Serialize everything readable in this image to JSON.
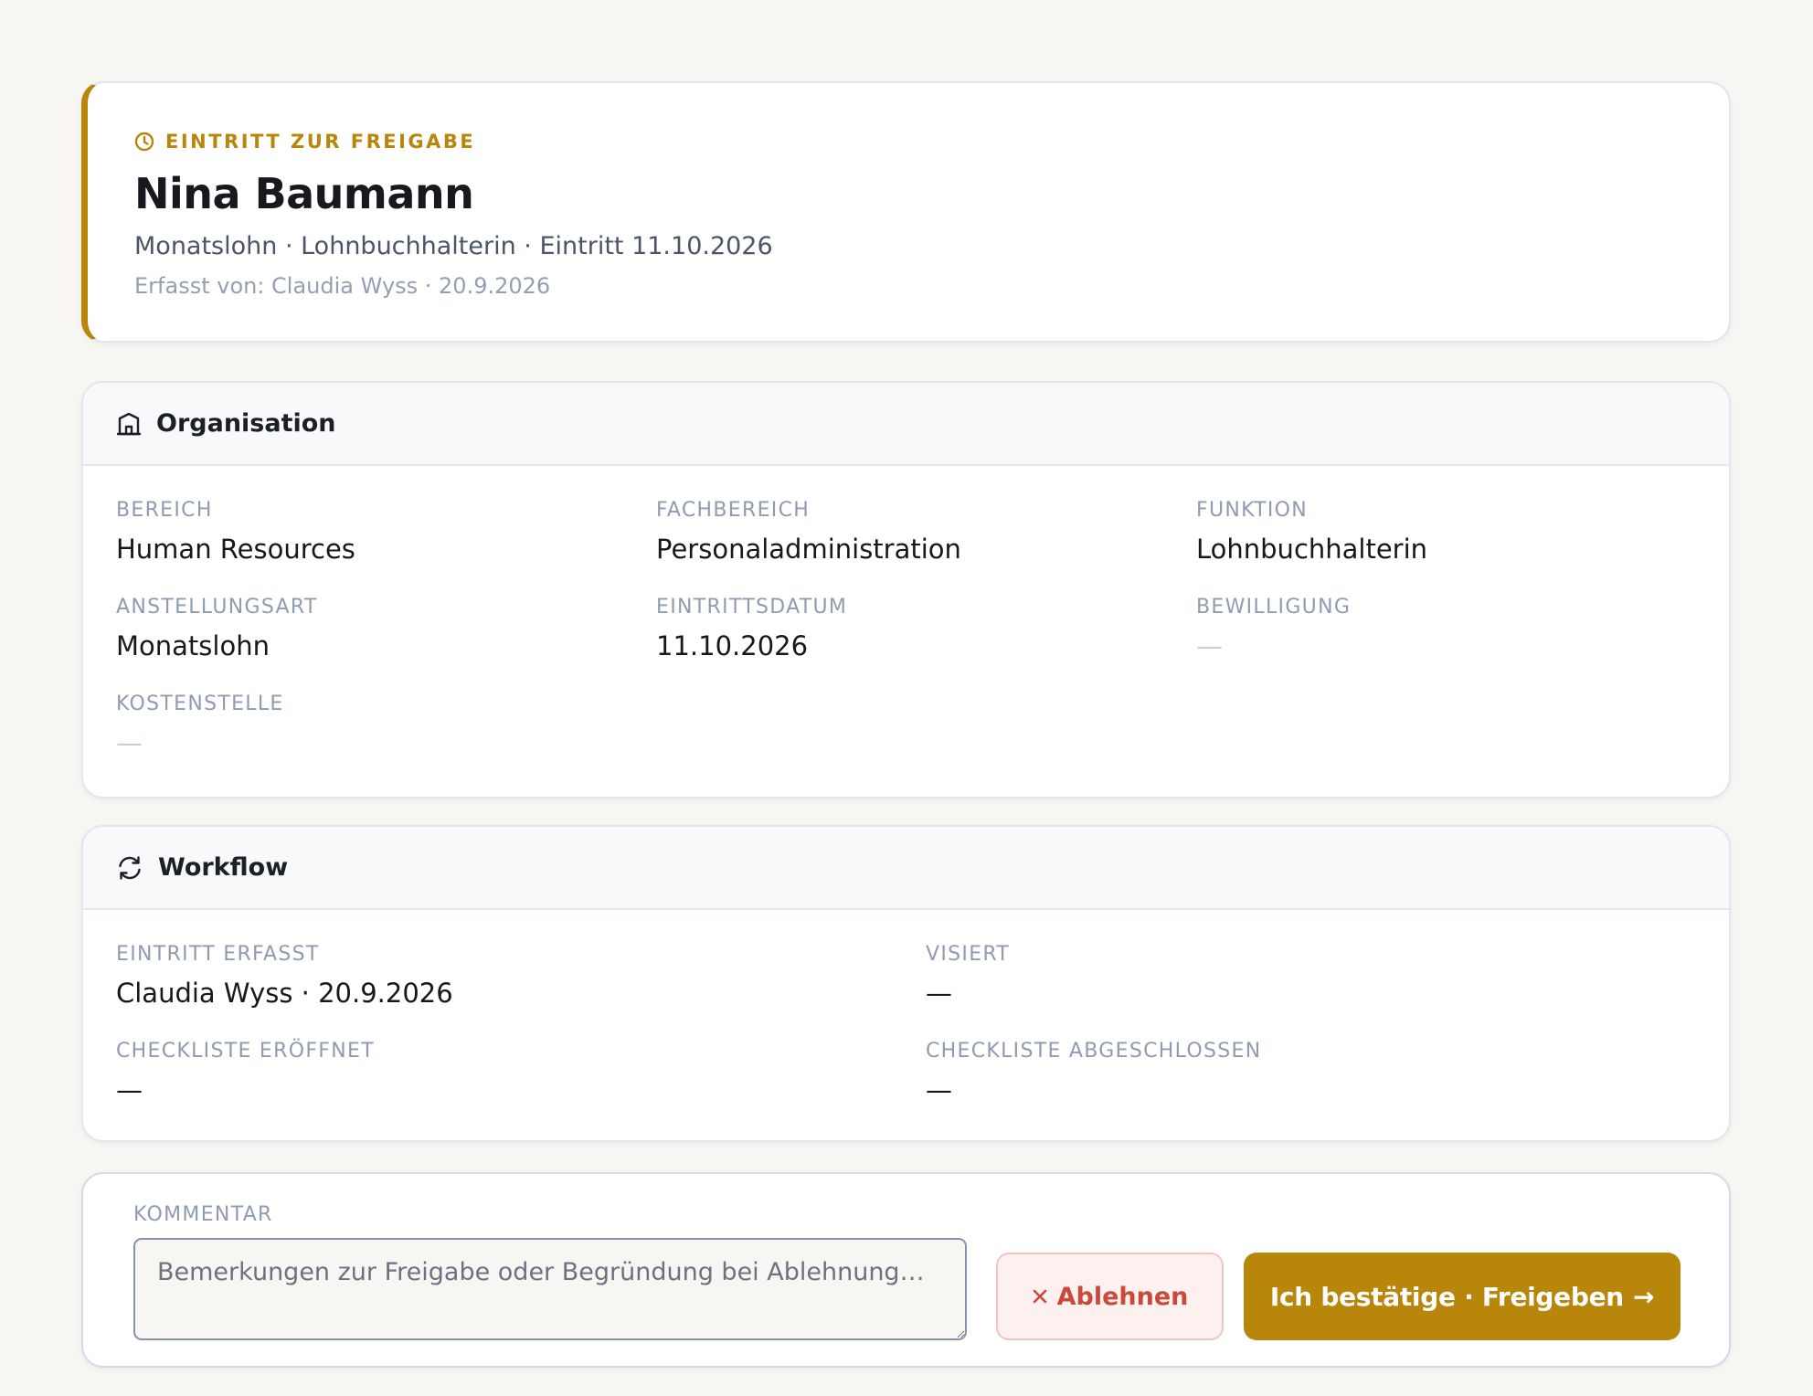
{
  "header": {
    "status": "EINTRITT ZUR FREIGABE",
    "name": "Nina Baumann",
    "summary": "Monatslohn · Lohnbuchhalterin · Eintritt 11.10.2026",
    "created": "Erfasst von: Claudia Wyss · 20.9.2026",
    "status_icon": "clock-icon"
  },
  "organisation": {
    "title": "Organisation",
    "icon": "building-icon",
    "fields": [
      {
        "label": "BEREICH",
        "value": "Human Resources"
      },
      {
        "label": "FACHBEREICH",
        "value": "Personaladministration"
      },
      {
        "label": "FUNKTION",
        "value": "Lohnbuchhalterin"
      },
      {
        "label": "ANSTELLUNGSART",
        "value": "Monatslohn"
      },
      {
        "label": "EINTRITTSDATUM",
        "value": "11.10.2026"
      },
      {
        "label": "BEWILLIGUNG",
        "value": "—"
      },
      {
        "label": "KOSTENSTELLE",
        "value": "—"
      }
    ]
  },
  "workflow": {
    "title": "Workflow",
    "icon": "refresh-icon",
    "fields": [
      {
        "label": "EINTRITT ERFASST",
        "value": "Claudia Wyss · 20.9.2026"
      },
      {
        "label": "VISIERT",
        "value": "—"
      },
      {
        "label": "CHECKLISTE ERÖFFNET",
        "value": "—"
      },
      {
        "label": "CHECKLISTE ABGESCHLOSSEN",
        "value": "—"
      }
    ]
  },
  "comment": {
    "label": "KOMMENTAR",
    "placeholder": "Bemerkungen zur Freigabe oder Begründung bei Ablehnung…",
    "value": ""
  },
  "actions": {
    "reject_label": "Ablehnen",
    "approve_label": "Ich bestätige · Freigeben",
    "approve_arrow": "→"
  },
  "colors": {
    "accent": "#b8860b",
    "reject": "#c94a3b",
    "background": "#f7f6f3"
  }
}
